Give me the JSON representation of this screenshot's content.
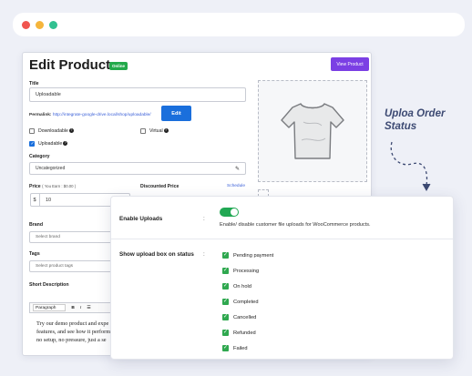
{
  "window": {
    "dots": [
      "#f0554f",
      "#f5b53c",
      "#32c191"
    ]
  },
  "product": {
    "heading": "Edit Product",
    "status_badge": "Online",
    "view_button": "View Product",
    "title_label": "Title",
    "title_value": "Uploadable",
    "permalink_label": "Permalink:",
    "permalink_url": "http://integrate-google-drive.local/shop/uploadable/",
    "edit_button": "Edit",
    "downloadable_label": "Downloadable",
    "virtual_label": "Virtual",
    "uploadable_label": "Uploadable",
    "category_label": "Category",
    "category_value": "Uncategorized",
    "price_label": "Price",
    "price_hint": "( You Earn : $0.00 )",
    "price_prefix": "$",
    "price_value": "10",
    "discounted_label": "Discounted Price",
    "schedule_link": "Schedule",
    "brand_label": "Brand",
    "brand_placeholder": "Select brand",
    "tags_label": "Tags",
    "tags_placeholder": "Select product tags",
    "short_desc_label": "Short Description",
    "editor_format": "Paragraph",
    "editor_text": [
      "Try our demo product and expe",
      "features, and see how it perform",
      "no setup, no pressure, just a se"
    ]
  },
  "settings": {
    "enable_uploads_label": "Enable Uploads",
    "enable_uploads_on": true,
    "enable_uploads_desc": "Enable/ disable customer file uploads for WooCommerce products.",
    "status_label": "Show upload box on status",
    "statuses": [
      "Pending payment",
      "Processing",
      "On hold",
      "Completed",
      "Cancelled",
      "Refunded",
      "Failed"
    ]
  },
  "annotation": {
    "line1": "Uploa Order",
    "line2": "Status"
  }
}
